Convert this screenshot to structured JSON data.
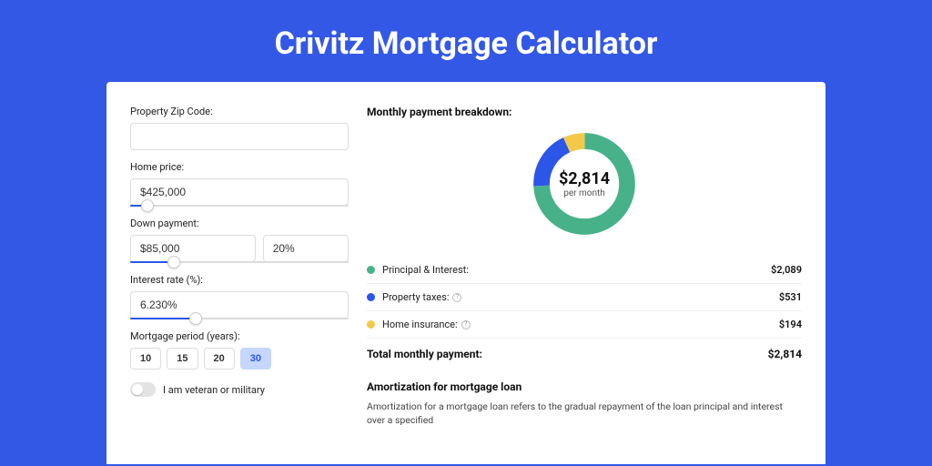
{
  "title": "Crivitz Mortgage Calculator",
  "form": {
    "zip": {
      "label": "Property Zip Code:",
      "value": ""
    },
    "home_price": {
      "label": "Home price:",
      "value": "$425,000",
      "slider_pct": 8
    },
    "down_payment": {
      "label": "Down payment:",
      "amount": "$85,000",
      "percent": "20%",
      "slider_pct": 20
    },
    "interest_rate": {
      "label": "Interest rate (%):",
      "value": "6.230%",
      "slider_pct": 30
    },
    "period": {
      "label": "Mortgage period (years):",
      "options": [
        "10",
        "15",
        "20",
        "30"
      ],
      "selected": "30"
    },
    "veteran": {
      "label": "I am veteran or military",
      "checked": false
    }
  },
  "breakdown": {
    "title": "Monthly payment breakdown:",
    "center_amount": "$2,814",
    "center_sub": "per month",
    "items": [
      {
        "label": "Principal & Interest:",
        "value": "$2,089",
        "color": "green",
        "info": false
      },
      {
        "label": "Property taxes:",
        "value": "$531",
        "color": "blue",
        "info": true
      },
      {
        "label": "Home insurance:",
        "value": "$194",
        "color": "yellow",
        "info": true
      }
    ],
    "total_label": "Total monthly payment:",
    "total_value": "$2,814"
  },
  "chart_data": {
    "type": "pie",
    "title": "Monthly payment breakdown",
    "series": [
      {
        "name": "Principal & Interest",
        "value": 2089,
        "color": "#47b28a"
      },
      {
        "name": "Property taxes",
        "value": 531,
        "color": "#2b56e8"
      },
      {
        "name": "Home insurance",
        "value": 194,
        "color": "#f3c94b"
      }
    ],
    "center_value": 2814,
    "center_label": "per month"
  },
  "amortization": {
    "title": "Amortization for mortgage loan",
    "text": "Amortization for a mortgage loan refers to the gradual repayment of the loan principal and interest over a specified"
  }
}
